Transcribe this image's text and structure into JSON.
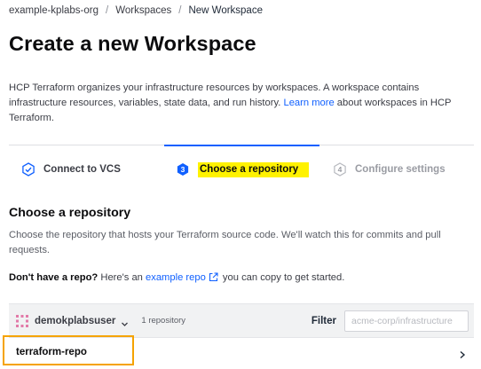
{
  "breadcrumb": {
    "items": [
      "example-kplabs-org",
      "Workspaces",
      "New Workspace"
    ],
    "separator": "/"
  },
  "page": {
    "title": "Create a new Workspace",
    "intro_text": "HCP Terraform organizes your infrastructure resources by workspaces. A workspace contains infrastructure resources, variables, state data, and run history.",
    "intro_link": "Learn more",
    "intro_suffix": "about workspaces in HCP Terraform."
  },
  "steps": [
    {
      "label": "Connect to VCS",
      "state": "complete",
      "icon": "check-hexagon-icon"
    },
    {
      "label": "Choose a repository",
      "state": "active",
      "number": "3",
      "icon": "number-hexagon-icon"
    },
    {
      "label": "Configure settings",
      "state": "upcoming",
      "number": "4",
      "icon": "number-hexagon-icon"
    }
  ],
  "section": {
    "title": "Choose a repository",
    "description": "Choose the repository that hosts your Terraform source code. We'll watch this for commits and pull requests.",
    "no_repo_bold": "Don't have a repo?",
    "no_repo_text": "Here's an",
    "no_repo_link": "example repo",
    "no_repo_suffix": "you can copy to get started."
  },
  "repo_list": {
    "org_name": "demokplabsuser",
    "repo_count": "1 repository",
    "filter_label": "Filter",
    "filter_placeholder": "acme-corp/infrastructure",
    "repos": [
      {
        "name": "terraform-repo"
      }
    ]
  },
  "colors": {
    "link": "#1060ff",
    "highlight_yellow": "#fff200",
    "highlight_box": "#f5a300",
    "org_icon": "#e27aa8"
  }
}
